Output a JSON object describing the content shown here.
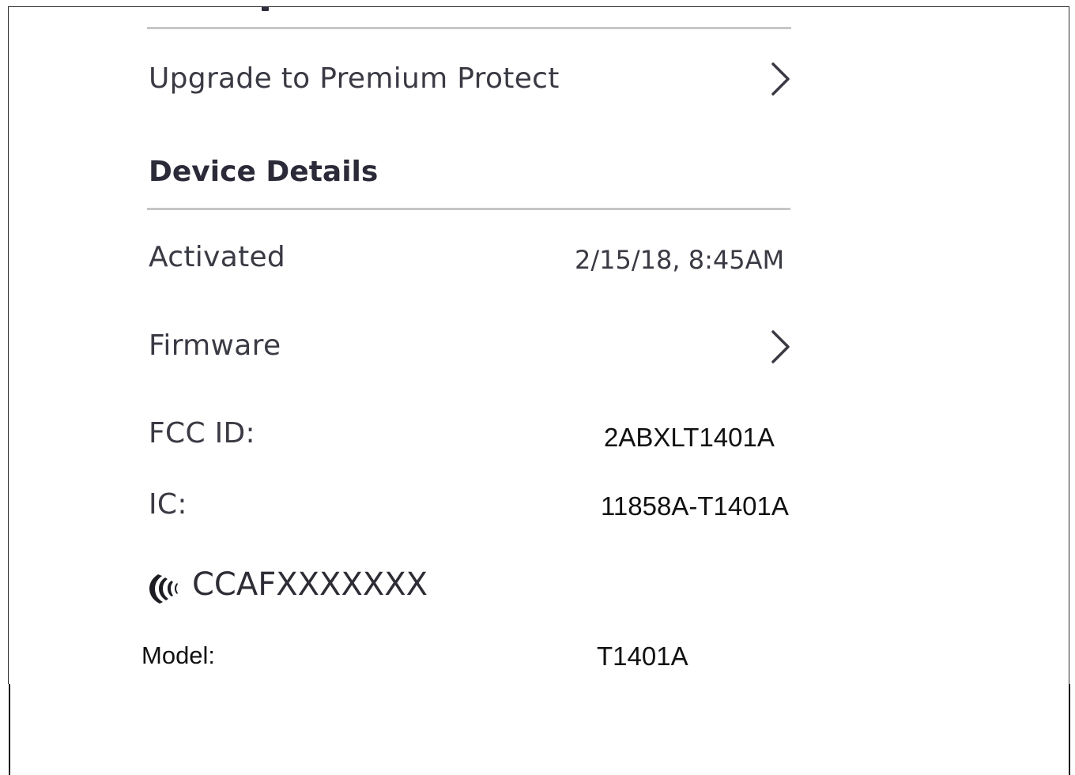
{
  "upgrade_row": {
    "label": "Upgrade to Premium Protect",
    "chevron_icon": "chevron-right-icon"
  },
  "device_details": {
    "heading": "Device Details",
    "rows": {
      "activated": {
        "label": "Activated",
        "value": "2/15/18, 8:45AM"
      },
      "firmware": {
        "label": "Firmware",
        "chevron_icon": "chevron-right-icon"
      },
      "fcc_id": {
        "label": "FCC ID:",
        "value": "2ABXLT1401A"
      },
      "ic": {
        "label": "IC:",
        "value": "11858A-T1401A"
      },
      "ccaf": {
        "icon": "ncc-certification-icon",
        "value": "CCAFXXXXXXX"
      },
      "model": {
        "label": "Model:",
        "value": "T1401A"
      }
    }
  },
  "colors": {
    "text_primary": "#3a3a44",
    "heading": "#2b2a38",
    "divider": "#c6c6c8",
    "label_plain": "#111111"
  }
}
